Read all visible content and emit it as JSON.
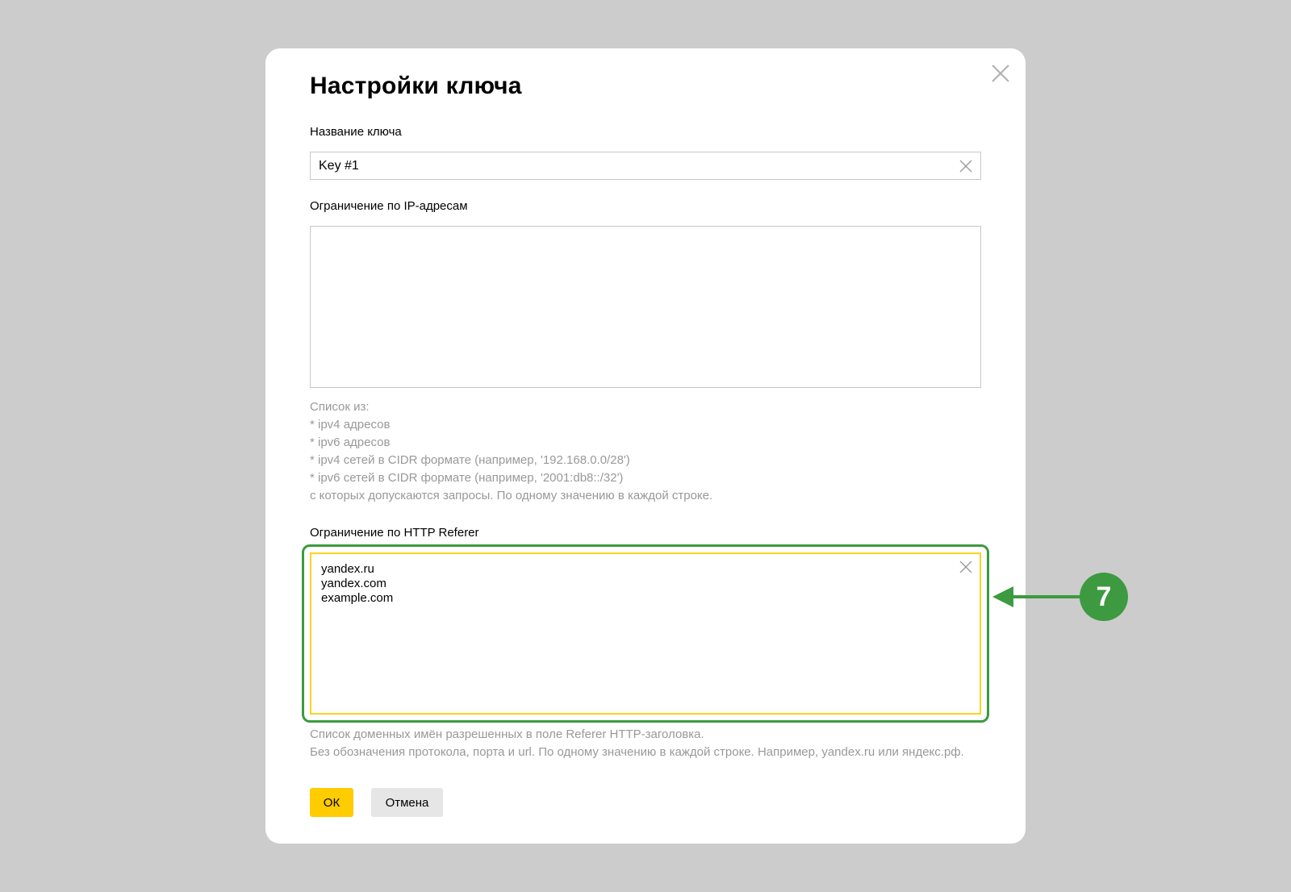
{
  "dialog": {
    "title": "Настройки ключа",
    "close_icon": "close-icon"
  },
  "key_name": {
    "label": "Название ключа",
    "value": "Key #1",
    "clear_icon": "clear-icon"
  },
  "ip_restriction": {
    "label": "Ограничение по IP-адресам",
    "value": "",
    "hint_lines": [
      "Список из:",
      "* ipv4 адресов",
      "* ipv6 адресов",
      "* ipv4 сетей в CIDR формате (например, '192.168.0.0/28')",
      "* ipv6 сетей в CIDR формате (например, '2001:db8::/32')",
      "с которых допускаются запросы. По одному значению в каждой строке."
    ]
  },
  "referer_restriction": {
    "label": "Ограничение по HTTP Referer",
    "value": "yandex.ru\nyandex.com\nexample.com",
    "clear_icon": "clear-icon",
    "hint_lines": [
      "Список доменных имён разрешенных в поле Referer HTTP-заголовка.",
      "Без обозначения протокола, порта и url. По одному значению в каждой строке. Например, yandex.ru или яндекс.рф."
    ]
  },
  "buttons": {
    "ok_label": "ОК",
    "cancel_label": "Отмена"
  },
  "callout": {
    "number": "7",
    "color": "#3d9a40"
  },
  "colors": {
    "background": "#cccccc",
    "accent_yellow": "#ffcc00",
    "focus_border": "#ffd21f",
    "hint_text": "#999999"
  }
}
